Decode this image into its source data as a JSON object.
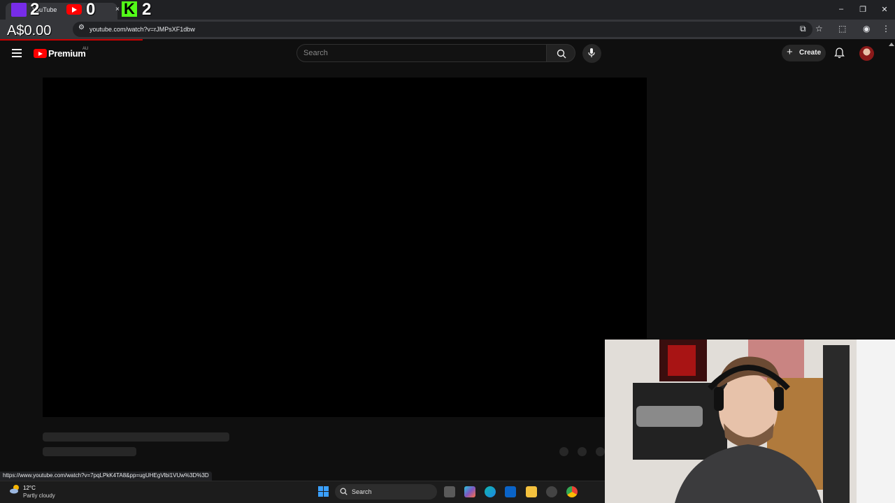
{
  "browser": {
    "tab_title": "YouTube",
    "url": "youtube.com/watch?v=rJMPsXF1dbw",
    "status_url": "https://www.youtube.com/watch?v=7pqLPkK4TA8&pp=ugUHEgVlbi1VUw%3D%3D"
  },
  "overlay": {
    "twitch_count": "2",
    "youtube_count": "0",
    "kick_count": "2",
    "money": "A$0.00",
    "colors": {
      "twitch": "#772ce8",
      "youtube": "#ff0000",
      "kick": "#53fc18"
    }
  },
  "youtube": {
    "logo_text": "Premium",
    "country_code": "AU",
    "search_placeholder": "Search",
    "create_label": "Create",
    "brand_color": "#ff0000"
  },
  "taskbar": {
    "weather_temp": "12°C",
    "weather_desc": "Partly cloudy",
    "search_label": "Search"
  }
}
